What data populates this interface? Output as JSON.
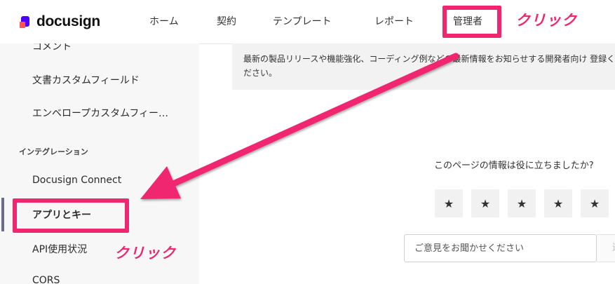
{
  "brand": {
    "logo_text": "docusign",
    "accent": "#f0276f"
  },
  "nav": {
    "items": [
      {
        "label": "ホーム"
      },
      {
        "label": "契約"
      },
      {
        "label": "テンプレート"
      },
      {
        "label": "レポート"
      },
      {
        "label": "管理者"
      }
    ]
  },
  "sidebar": {
    "items": [
      {
        "label": "コメント"
      },
      {
        "label": "文書カスタムフィールド"
      },
      {
        "label": "エンベロープカスタムフィー…"
      }
    ],
    "section_title": "インテグレーション",
    "integration_items": [
      {
        "label": "Docusign Connect"
      },
      {
        "label": "アプリとキー"
      },
      {
        "label": "API使用状況"
      },
      {
        "label": "CORS"
      }
    ]
  },
  "banner": {
    "text": "最新の製品リリースや機能強化、コーディング例などの最新情報をお知らせする開発者向け 登録ください。"
  },
  "feedback": {
    "question": "このページの情報は役に立ちましたか?",
    "star_glyph": "★",
    "input_placeholder": "ご意見をお聞かせください",
    "submit_label": "送信"
  },
  "annotations": {
    "click_top": "クリック",
    "click_side": "クリック"
  }
}
